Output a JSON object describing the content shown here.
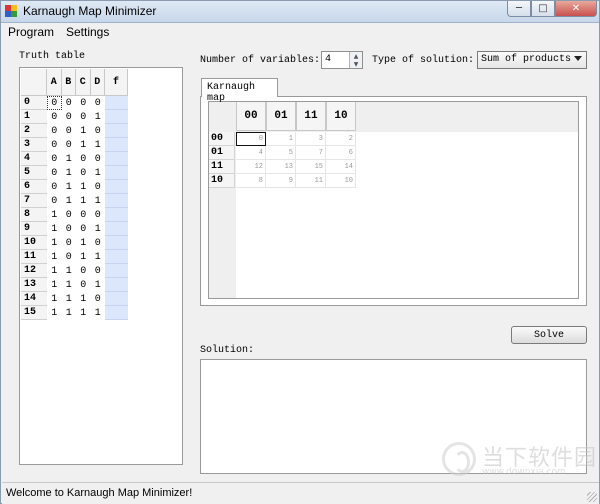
{
  "window": {
    "title": "Karnaugh Map Minimizer",
    "minimize_glyph": "─",
    "maximize_glyph": "□",
    "close_glyph": "✕"
  },
  "menu": [
    "Program",
    "Settings"
  ],
  "truth_table": {
    "label": "Truth table",
    "headers": [
      "A",
      "B",
      "C",
      "D",
      "f"
    ],
    "rows": [
      {
        "index": "0",
        "bits": [
          "0",
          "0",
          "0",
          "0"
        ]
      },
      {
        "index": "1",
        "bits": [
          "0",
          "0",
          "0",
          "1"
        ]
      },
      {
        "index": "2",
        "bits": [
          "0",
          "0",
          "1",
          "0"
        ]
      },
      {
        "index": "3",
        "bits": [
          "0",
          "0",
          "1",
          "1"
        ]
      },
      {
        "index": "4",
        "bits": [
          "0",
          "1",
          "0",
          "0"
        ]
      },
      {
        "index": "5",
        "bits": [
          "0",
          "1",
          "0",
          "1"
        ]
      },
      {
        "index": "6",
        "bits": [
          "0",
          "1",
          "1",
          "0"
        ]
      },
      {
        "index": "7",
        "bits": [
          "0",
          "1",
          "1",
          "1"
        ]
      },
      {
        "index": "8",
        "bits": [
          "1",
          "0",
          "0",
          "0"
        ]
      },
      {
        "index": "9",
        "bits": [
          "1",
          "0",
          "0",
          "1"
        ]
      },
      {
        "index": "10",
        "bits": [
          "1",
          "0",
          "1",
          "0"
        ]
      },
      {
        "index": "11",
        "bits": [
          "1",
          "0",
          "1",
          "1"
        ]
      },
      {
        "index": "12",
        "bits": [
          "1",
          "1",
          "0",
          "0"
        ]
      },
      {
        "index": "13",
        "bits": [
          "1",
          "1",
          "0",
          "1"
        ]
      },
      {
        "index": "14",
        "bits": [
          "1",
          "1",
          "1",
          "0"
        ]
      },
      {
        "index": "15",
        "bits": [
          "1",
          "1",
          "1",
          "1"
        ]
      }
    ]
  },
  "controls": {
    "vars_label": "Number of variables:",
    "vars_value": "4",
    "type_label": "Type of solution:",
    "type_value": "Sum of products"
  },
  "kmap": {
    "tab_label": "Karnaugh map",
    "col_headers": [
      "00",
      "01",
      "11",
      "10"
    ],
    "row_headers": [
      "00",
      "01",
      "11",
      "10"
    ],
    "cells": [
      [
        "0",
        "1",
        "3",
        "2"
      ],
      [
        "4",
        "5",
        "7",
        "6"
      ],
      [
        "12",
        "13",
        "15",
        "14"
      ],
      [
        "8",
        "9",
        "11",
        "10"
      ]
    ]
  },
  "solve_label": "Solve",
  "solution_label": "Solution:",
  "status": "Welcome to Karnaugh Map Minimizer!",
  "watermark": {
    "cn": "当下软件园",
    "en": "www.downxia.com"
  },
  "colors": {
    "f_column": "#dde7fb",
    "selection": "#111111"
  }
}
